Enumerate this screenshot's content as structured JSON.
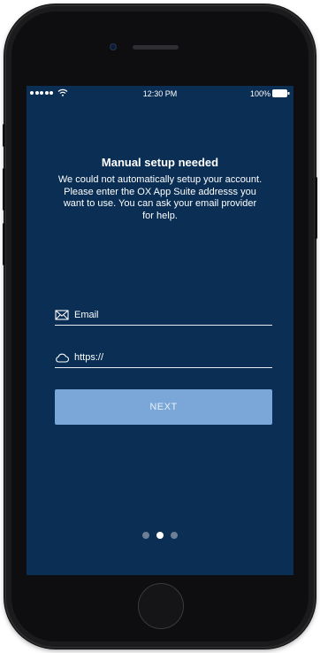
{
  "status_bar": {
    "time": "12:30 PM",
    "battery": "100%",
    "icons": [
      "signal-dots-icon",
      "wifi-icon",
      "battery-icon"
    ]
  },
  "setup": {
    "title": "Manual setup needed",
    "message": "We could not automatically setup your account. Please enter the OX App Suite addresss you want to use. You can ask your email provider for help."
  },
  "form": {
    "email": {
      "placeholder": "Email",
      "value": "",
      "icon": "envelope-icon"
    },
    "server": {
      "placeholder": "https://",
      "value": "",
      "icon": "cloud-icon"
    },
    "next_label": "NEXT"
  },
  "pager": {
    "total": 3,
    "active": 2
  },
  "colors": {
    "screen_bg": "#0a2e54",
    "button_bg": "#7aa7d7",
    "text": "#ffffff"
  }
}
